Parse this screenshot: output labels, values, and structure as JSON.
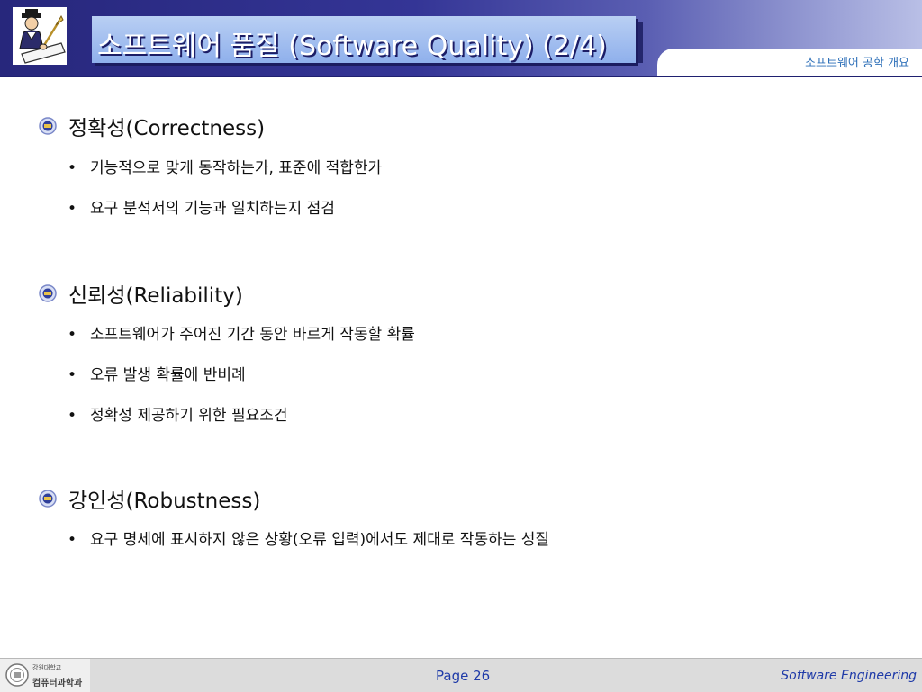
{
  "header": {
    "title": "소프트웨어 품질 (Software Quality) (2/4)",
    "subtitle": "소프트웨어 공학 개요",
    "colors": {
      "bar": "#2a2a80",
      "title_panel": "#9fbcef",
      "subtitle_text": "#2d6fb8"
    }
  },
  "sections": [
    {
      "title": "정확성(Correctness)",
      "items": [
        "기능적으로 맞게 동작하는가, 표준에 적합한가",
        "요구 분석서의 기능과 일치하는지 점검"
      ]
    },
    {
      "title": "신뢰성(Reliability)",
      "items": [
        "소프트웨어가 주어진 기간 동안 바르게 작동할 확률",
        "오류 발생 확률에 반비례",
        "정확성 제공하기 위한 필요조건"
      ]
    },
    {
      "title": "강인성(Robustness)",
      "items": [
        "요구 명세에 표시하지 않은 상황(오류 입력)에서도 제대로 작동하는 성질"
      ]
    }
  ],
  "footer": {
    "institution": "강원대학교",
    "department": "컴퓨터과학과",
    "page": "Page 26",
    "right": "Software Engineering"
  }
}
